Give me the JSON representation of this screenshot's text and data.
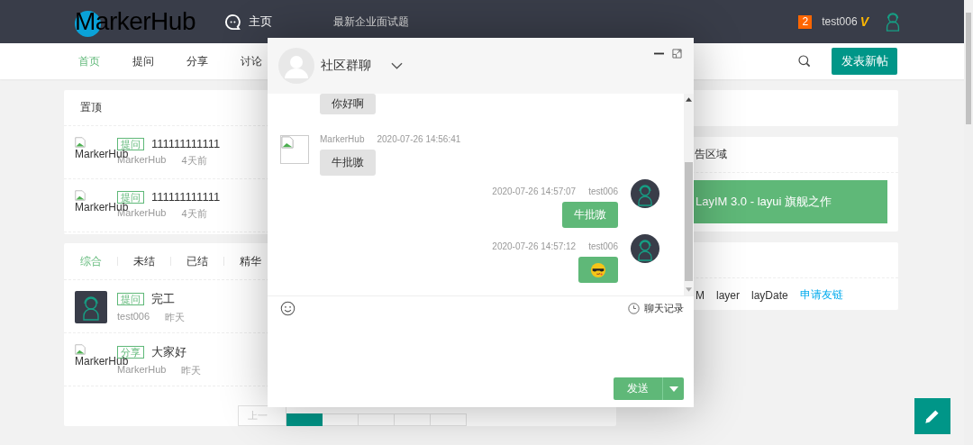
{
  "header": {
    "logo": "MarkerHub",
    "nav": [
      {
        "label": "主页"
      },
      {
        "label": "最新企业面试题"
      }
    ],
    "message_count": "2",
    "username": "test006",
    "vip_mark": "V"
  },
  "subnav": {
    "items": [
      {
        "label": "首页",
        "selected": true
      },
      {
        "label": "提问",
        "selected": false
      },
      {
        "label": "分享",
        "selected": false
      },
      {
        "label": "讨论",
        "selected": false
      }
    ],
    "post_button": "发表新帖"
  },
  "top_posts": {
    "title": "置顶",
    "posts": [
      {
        "kind": "broken",
        "avatar_alt": "MarkerHub",
        "tag": "提问",
        "title": "111111111111",
        "author": "MarkerHub",
        "time": "4天前"
      },
      {
        "kind": "broken",
        "avatar_alt": "MarkerHub",
        "tag": "提问",
        "title": "111111111111",
        "author": "MarkerHub",
        "time": "4天前"
      }
    ]
  },
  "post_list": {
    "filters": [
      {
        "label": "综合",
        "selected": true
      },
      {
        "label": "未结",
        "selected": false
      },
      {
        "label": "已结",
        "selected": false
      },
      {
        "label": "精华",
        "selected": false
      }
    ],
    "posts": [
      {
        "kind": "user",
        "tag": "提问",
        "title": "完工",
        "author": "test006",
        "time": "昨天"
      },
      {
        "kind": "broken",
        "avatar_alt": "MarkerHub",
        "tag": "分享",
        "title": "大家好",
        "author": "MarkerHub",
        "time": "昨天"
      }
    ],
    "pagination": {
      "prev": "上一"
    }
  },
  "sidebar": {
    "ad_title": "告区域",
    "ad_banner": "LayIM 3.0 - layui 旗舰之作",
    "links": [
      "M",
      "layer",
      "layDate"
    ],
    "apply_link": "申请友链"
  },
  "chat": {
    "title": "社区群聊",
    "messages": [
      {
        "mine": false,
        "kind": "text",
        "text": "你好啊"
      },
      {
        "mine": false,
        "kind": "text",
        "author": "MarkerHub",
        "time": "2020-07-26 14:56:41",
        "text": "牛批嗷"
      },
      {
        "mine": true,
        "kind": "text",
        "author": "test006",
        "time": "2020-07-26 14:57:07",
        "text": "牛批嗷"
      },
      {
        "mine": true,
        "kind": "emoji",
        "author": "test006",
        "time": "2020-07-26 14:57:12"
      }
    ],
    "history_label": "聊天记录",
    "send_button": "发送"
  }
}
